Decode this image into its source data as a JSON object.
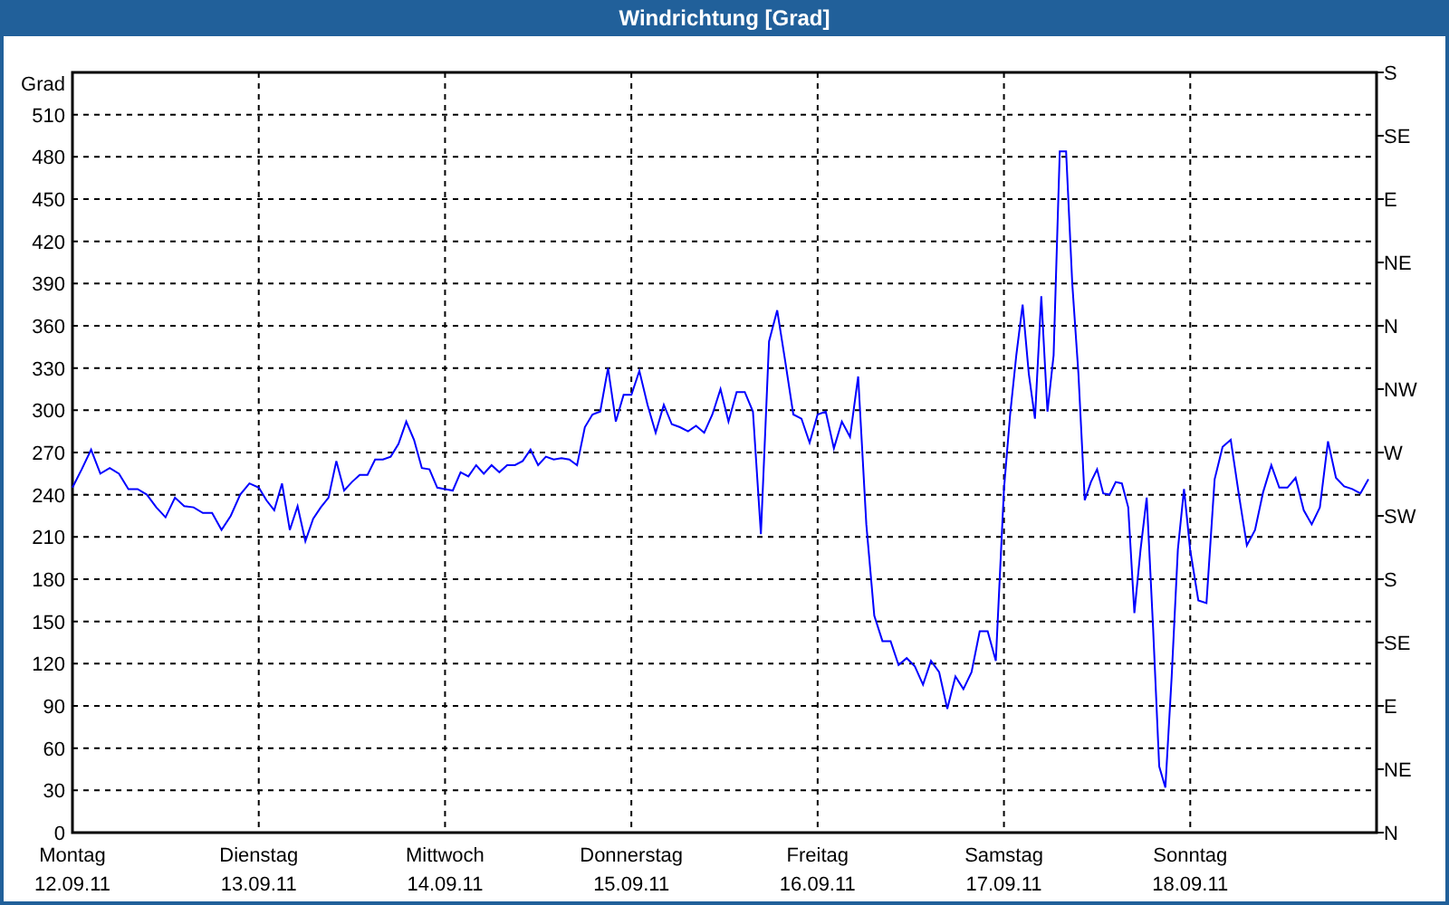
{
  "window": {
    "title": "Windrichtung [Grad]"
  },
  "chart_data": {
    "type": "line",
    "ylabel": "Grad",
    "ylim": [
      0,
      540
    ],
    "grid": true,
    "categories": [
      "Montag\n12.09.11",
      null,
      null,
      null,
      null,
      null,
      null,
      null,
      null,
      null,
      null,
      null,
      null,
      null,
      null,
      null,
      null,
      null,
      null,
      null,
      "Dienstag\n13.09.11",
      null,
      null,
      null,
      null,
      null,
      null,
      null,
      null,
      null,
      null,
      null,
      null,
      null,
      null,
      null,
      null,
      null,
      null,
      null,
      null,
      null,
      null,
      null,
      "Mittwoch\n14.09.11",
      null,
      null,
      null,
      null,
      null,
      null,
      null,
      null,
      null,
      null,
      null,
      null,
      null,
      null,
      null,
      null,
      null,
      null,
      null,
      null,
      null,
      null,
      null,
      "Donnerstag\n15.09.11",
      null,
      null,
      null,
      null,
      null,
      null,
      null,
      null,
      null,
      null,
      null,
      null,
      null,
      null,
      null,
      null,
      null,
      null,
      null,
      null,
      null,
      null,
      "Freitag\n16.09.11",
      null,
      null,
      null,
      null,
      null,
      null,
      null,
      null,
      null,
      null,
      null,
      null,
      null,
      null,
      null,
      null,
      null,
      null,
      null,
      null,
      null,
      null,
      "Samstag\n17.09.11",
      null,
      null,
      null,
      null,
      null,
      null,
      null,
      null,
      null,
      null,
      null,
      null,
      null,
      null,
      null,
      null,
      null,
      null,
      null,
      null,
      null,
      null,
      null,
      null,
      null,
      null,
      null,
      null,
      null,
      "Sonntag\n18.09.11",
      null,
      null,
      null,
      null,
      null,
      null,
      null,
      null,
      null,
      null,
      null,
      null,
      null,
      null,
      null,
      null,
      null,
      null,
      null,
      null,
      null,
      null
    ],
    "series": [
      {
        "color": "#0000ff",
        "values": [
          245,
          258,
          272,
          255,
          259,
          255,
          244,
          244,
          240,
          231,
          224,
          238,
          232,
          231,
          227,
          227,
          215,
          225,
          240,
          248,
          245,
          236,
          229,
          248,
          215,
          232,
          207,
          223,
          231,
          238,
          264,
          243,
          249,
          254,
          254,
          265,
          265,
          267,
          276,
          292,
          279,
          259,
          258,
          245,
          244,
          243,
          256,
          253,
          261,
          255,
          261,
          256,
          261,
          261,
          264,
          272,
          261,
          267,
          265,
          266,
          265,
          261,
          288,
          297,
          299,
          330,
          292,
          311,
          311,
          328,
          304,
          284,
          304,
          290,
          288,
          285,
          289,
          284,
          297,
          315,
          292,
          313,
          313,
          299,
          212,
          349,
          371,
          335,
          297,
          294,
          277,
          297,
          299,
          273,
          292,
          281,
          324,
          219,
          154,
          136,
          136,
          119,
          124,
          118,
          105,
          122,
          114,
          88,
          111,
          102,
          114,
          143,
          143,
          122,
          244,
          297,
          339,
          375,
          326,
          294,
          381,
          299,
          339,
          484,
          484,
          390,
          326,
          236,
          249,
          258,
          241,
          240,
          249,
          248,
          231,
          156,
          201,
          238,
          146,
          47,
          32,
          111,
          201,
          244,
          201,
          165,
          163,
          251,
          274,
          279,
          240,
          204,
          215,
          242,
          261,
          245,
          245,
          252,
          229,
          219,
          231,
          278,
          252,
          246,
          244,
          241,
          251
        ]
      }
    ],
    "yticks": [
      0,
      30,
      60,
      90,
      120,
      150,
      180,
      210,
      240,
      270,
      300,
      330,
      360,
      390,
      420,
      450,
      480,
      510
    ]
  },
  "compass_axis": {
    "labels": [
      "S",
      "SE",
      "E",
      "NE",
      "N",
      "NW",
      "W",
      "SW",
      "S",
      "SE",
      "E",
      "NE",
      "N"
    ]
  }
}
